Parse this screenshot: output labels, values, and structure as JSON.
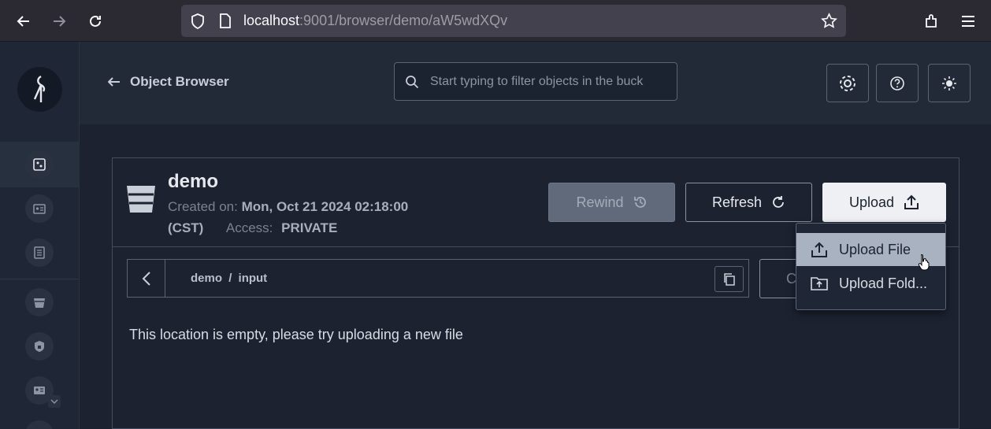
{
  "browser": {
    "url_host": "localhost",
    "url_rest": ":9001/browser/demo/aW5wdXQv"
  },
  "header": {
    "back_label": "Object Browser",
    "search_placeholder": "Start typing to filter objects in the buck"
  },
  "bucket": {
    "name": "demo",
    "created_label": "Created on:",
    "created_value": "Mon, Oct 21 2024 02:18:00",
    "created_tz": "(CST)",
    "access_label": "Access:",
    "access_value": "PRIVATE"
  },
  "actions": {
    "rewind": "Rewind",
    "refresh": "Refresh",
    "upload": "Upload"
  },
  "path": {
    "root": "demo",
    "separator": "/",
    "current": "input"
  },
  "partial_button": "C",
  "empty_message": "This location is empty, please try uploading a new file",
  "upload_menu": {
    "items": [
      {
        "label": "Upload File"
      },
      {
        "label": "Upload Fold..."
      }
    ]
  },
  "colors": {
    "background": "#1c2230",
    "sidebar": "#1f2736",
    "accent_light": "#eef0f3",
    "menu_highlight": "#a9b2c1"
  }
}
